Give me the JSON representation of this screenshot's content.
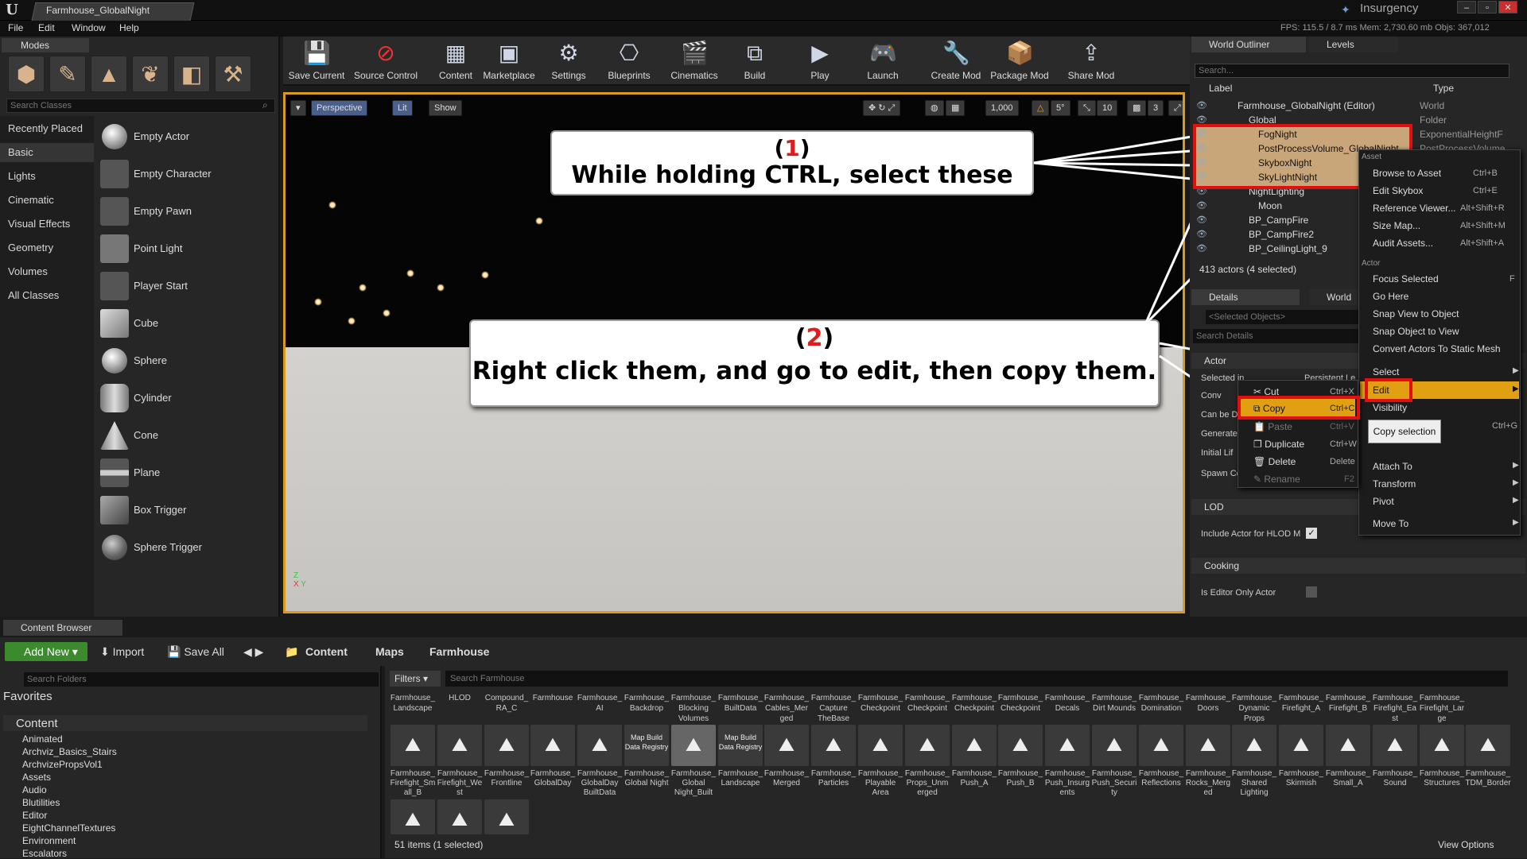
{
  "window": {
    "doc_tab": "Farmhouse_GlobalNight",
    "product": "Insurgency"
  },
  "menu": [
    "File",
    "Edit",
    "Window",
    "Help"
  ],
  "stats": "FPS: 115.5 / 8.7 ms   Mem: 2,730.60 mb   Objs: 367,012",
  "modes": {
    "tab": "Modes",
    "search_placeholder": "Search Classes",
    "categories": [
      "Recently Placed",
      "Basic",
      "Lights",
      "Cinematic",
      "Visual Effects",
      "Geometry",
      "Volumes",
      "All Classes"
    ],
    "items": [
      "Empty Actor",
      "Empty Character",
      "Empty Pawn",
      "Point Light",
      "Player Start",
      "Cube",
      "Sphere",
      "Cylinder",
      "Cone",
      "Plane",
      "Box Trigger",
      "Sphere Trigger"
    ]
  },
  "toolbar": [
    "Save Current",
    "Source Control",
    "Content",
    "Marketplace",
    "Settings",
    "Blueprints",
    "Cinematics",
    "Build",
    "Play",
    "Launch",
    "Create Mod",
    "Package Mod",
    "Share Mod"
  ],
  "viewport": {
    "perspective": "Perspective",
    "lit": "Lit",
    "show": "Show",
    "grid": "1,000",
    "angle": "5°",
    "scale": "10",
    "speed": "3"
  },
  "callout1": {
    "num": "1",
    "text": "While holding CTRL, select these"
  },
  "callout2": {
    "num": "2",
    "text": "Right click them, and go to edit, then copy them."
  },
  "outliner": {
    "tab": "World Outliner",
    "tab2": "Levels",
    "search_placeholder": "Search...",
    "col_label": "Label",
    "col_type": "Type",
    "rows": [
      {
        "label": "Farmhouse_GlobalNight (Editor)",
        "type": "World"
      },
      {
        "label": "Global",
        "type": "Folder"
      },
      {
        "label": "FogNight",
        "type": "ExponentialHeightF"
      },
      {
        "label": "PostProcessVolume_GlobalNight",
        "type": "PostProcessVolume"
      },
      {
        "label": "SkyboxNight",
        "type": ""
      },
      {
        "label": "SkyLightNight",
        "type": ""
      },
      {
        "label": "NightLighting",
        "type": ""
      },
      {
        "label": "Moon",
        "type": ""
      },
      {
        "label": "BP_CampFire",
        "type": ""
      },
      {
        "label": "BP_CampFire2",
        "type": ""
      },
      {
        "label": "BP_CeilingLight_9",
        "type": ""
      }
    ],
    "count": "413 actors (4 selected)"
  },
  "details": {
    "tab": "Details",
    "tab2": "World",
    "selected": "<Selected Objects>",
    "search_placeholder": "Search Details",
    "sec_actor": "Actor",
    "props": [
      "Selected in",
      "Conv",
      "Can be D",
      "Generate",
      "Initial Lif",
      "Spawn Co"
    ],
    "persistent": "Persistent Le",
    "sec_lod": "LOD",
    "lod_prop": "Include Actor for HLOD M",
    "sec_cooking": "Cooking",
    "cook_prop": "Is Editor Only Actor"
  },
  "context_menu": {
    "asset_header": "Asset",
    "asset_items": [
      {
        "label": "Browse to Asset",
        "short": "Ctrl+B"
      },
      {
        "label": "Edit Skybox",
        "short": "Ctrl+E"
      },
      {
        "label": "Reference Viewer...",
        "short": "Alt+Shift+R"
      },
      {
        "label": "Size Map...",
        "short": "Alt+Shift+M"
      },
      {
        "label": "Audit Assets...",
        "short": "Alt+Shift+A"
      }
    ],
    "actor_header": "Actor",
    "actor_items": [
      "Focus Selected",
      "Go Here",
      "Snap View to Object",
      "Snap Object to View",
      "Convert Actors To Static Mesh"
    ],
    "focus_short": "F",
    "select": "Select",
    "edit": "Edit",
    "visibility": "Visibility",
    "visibility_short": "Ctrl+G",
    "tooltip": "Copy selection",
    "lower": [
      "Attach To",
      "Transform",
      "Pivot",
      "Move To"
    ]
  },
  "edit_menu": [
    {
      "label": "Cut",
      "short": "Ctrl+X"
    },
    {
      "label": "Copy",
      "short": "Ctrl+C"
    },
    {
      "label": "Paste",
      "short": "Ctrl+V"
    },
    {
      "label": "Duplicate",
      "short": "Ctrl+W"
    },
    {
      "label": "Delete",
      "short": "Delete"
    },
    {
      "label": "Rename",
      "short": "F2"
    }
  ],
  "content_browser": {
    "tab": "Content Browser",
    "add_new": "Add New",
    "import": "Import",
    "save_all": "Save All",
    "path": [
      "Content",
      "Maps",
      "Farmhouse"
    ],
    "search_folders": "Search Folders",
    "favorites": "Favorites",
    "root": "Content",
    "folders": [
      "Animated",
      "Archviz_Basics_Stairs",
      "ArchvizePropsVol1",
      "Assets",
      "Audio",
      "Blutilities",
      "Editor",
      "EightChannelTextures",
      "Environment",
      "Escalators"
    ],
    "filters": "Filters",
    "search_placeholder": "Search Farmhouse",
    "top_labels": [
      "Farmhouse_Landscape",
      "HLOD",
      "Compound_RA_C",
      "Farmhouse",
      "Farmhouse_AI",
      "Farmhouse_Backdrop",
      "Farmhouse_Blocking Volumes",
      "Farmhouse_BuiltData",
      "Farmhouse_Cables_Merged",
      "Farmhouse_Capture TheBase",
      "Farmhouse_Checkpoint",
      "Farmhouse_Checkpoint",
      "Farmhouse_Checkpoint",
      "Farmhouse_Checkpoint",
      "Farmhouse_Decals",
      "Farmhouse_Dirt Mounds",
      "Farmhouse_Domination",
      "Farmhouse_Doors",
      "Farmhouse_Dynamic Props",
      "Farmhouse_Firefight_A",
      "Farmhouse_Firefight_B",
      "Farmhouse_Firefight_East",
      "Farmhouse_Firefight_Large"
    ],
    "bottom_labels": [
      "Farmhouse_Firefight_Small_B",
      "Farmhouse_Firefight_West",
      "Farmhouse_Frontline",
      "Farmhouse_GlobalDay",
      "Farmhouse_GlobalDay BuiltData",
      "Farmhouse_Global Night",
      "Farmhouse_Global Night_Built",
      "Farmhouse_Landscape",
      "Farmhouse_Merged",
      "Farmhouse_Particles",
      "Farmhouse_Playable Area",
      "Farmhouse_Props_Unmerged",
      "Farmhouse_Push_A",
      "Farmhouse_Push_B",
      "Farmhouse_Push_Insurgents",
      "Farmhouse_Push_Security",
      "Farmhouse_Reflections",
      "Farmhouse_Rocks_Merged",
      "Farmhouse_Shared Lighting",
      "Farmhouse_Skirmish",
      "Farmhouse_Small_A",
      "Farmhouse_Sound",
      "Farmhouse_Structures",
      "Farmhouse_TDM_Border"
    ],
    "map_build": "Map Build Data Registry",
    "count": "51 items (1 selected)",
    "view_options": "View Options"
  }
}
